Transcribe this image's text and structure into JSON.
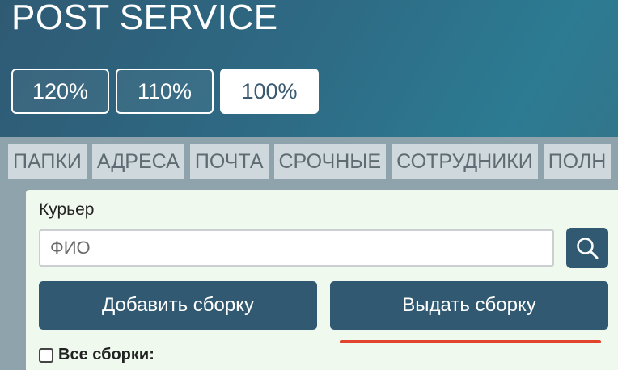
{
  "header": {
    "title": "POST SERVICE"
  },
  "zoom": {
    "options": [
      "120%",
      "110%",
      "100%"
    ],
    "selected": "100%"
  },
  "tabs": [
    {
      "label": "ПАПКИ"
    },
    {
      "label": "АДРЕСА"
    },
    {
      "label": "ПОЧТА"
    },
    {
      "label": "СРОЧНЫЕ"
    },
    {
      "label": "СОТРУДНИКИ"
    },
    {
      "label": "ПОЛН"
    }
  ],
  "form": {
    "courier_label": "Курьер",
    "courier_placeholder": "ФИО",
    "courier_value": "",
    "add_button": "Добавить сборку",
    "issue_button": "Выдать сборку",
    "all_label": "Все сборки:"
  },
  "colors": {
    "accent": "#315a72",
    "underline": "#e2452e",
    "panel_bg": "#eff9ee"
  },
  "icons": {
    "search": "search-icon"
  }
}
